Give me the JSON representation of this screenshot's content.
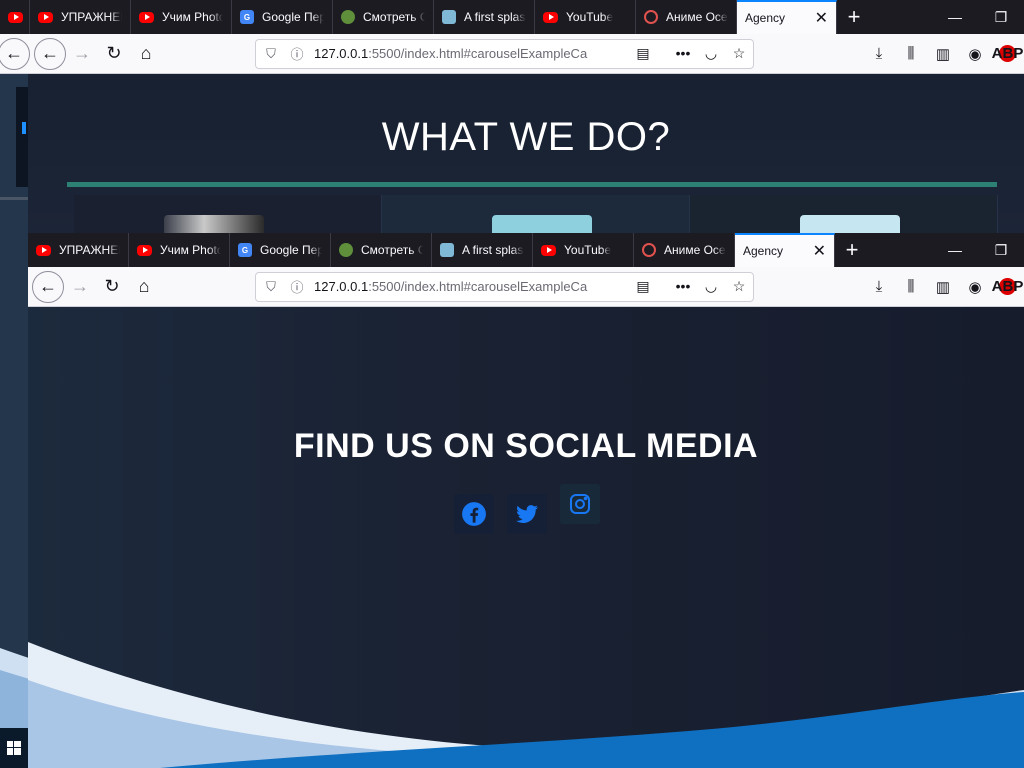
{
  "browser": {
    "tabs": [
      {
        "label": "",
        "icon": "youtube-icon"
      },
      {
        "label": "УПРАЖНЕНИЯ",
        "icon": "youtube-icon"
      },
      {
        "label": "Учим Photoshop",
        "icon": "youtube-icon"
      },
      {
        "label": "Google Переводчик",
        "icon": "google-translate-icon"
      },
      {
        "label": "Смотреть Смешарики",
        "icon": "smeshariki-icon"
      },
      {
        "label": "A first splash",
        "icon": "mdn-icon"
      },
      {
        "label": "YouTube",
        "icon": "youtube-icon"
      },
      {
        "label": "Аниме Осень",
        "icon": "anime-icon"
      },
      {
        "label": "Agency",
        "icon": "",
        "active": true
      }
    ],
    "url_host": "127.0.0.1",
    "url_path": ":5500/index.html#carouselExampleCa",
    "abp_label": "ABP",
    "accent": "#0a84ff"
  },
  "section_what": {
    "title": "WHAT WE DO?",
    "rule_color": "#2d8074"
  },
  "section_social": {
    "title": "FIND US ON SOCIAL MEDIA",
    "icons": [
      "facebook-icon",
      "twitter-icon",
      "instagram-icon"
    ],
    "icon_color": "#1877f2"
  },
  "colors": {
    "page_bg": "#1b2335",
    "wave_light": "#cfe0f2",
    "wave_mid": "#8fb4dc",
    "wave_dark": "#0f6fc0"
  }
}
